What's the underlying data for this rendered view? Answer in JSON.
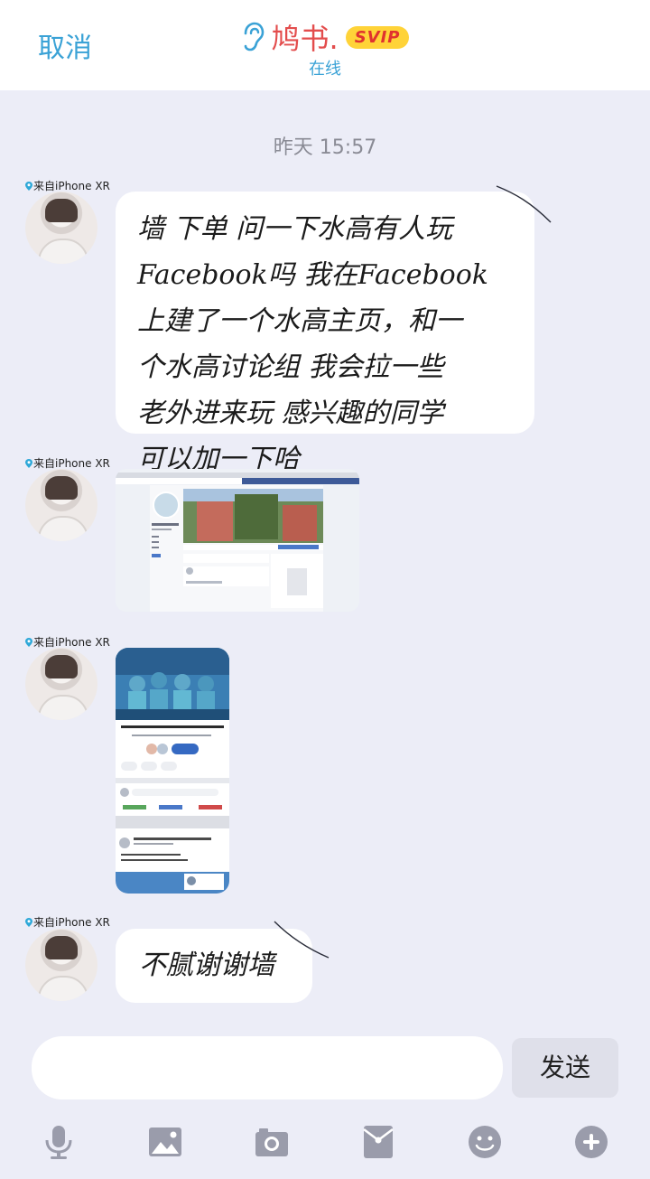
{
  "header": {
    "cancel_label": "取消",
    "title": "鸠书.",
    "badge": "SVIP",
    "status": "在线"
  },
  "chat": {
    "timestamp": "昨天 15:57",
    "messages": [
      {
        "source": "来自iPhone XR",
        "type": "text",
        "lines": [
          "墙 下单 问一下水高有人玩",
          "Facebook吗 我在Facebook",
          "上建了一个水高主页，和一",
          "个水高讨论组 我会拉一些",
          "老外进来玩 感兴趣的同学",
          "可以加一下哈"
        ]
      },
      {
        "source": "来自iPhone XR",
        "type": "image"
      },
      {
        "source": "来自iPhone XR",
        "type": "image"
      },
      {
        "source": "来自iPhone XR",
        "type": "text",
        "lines": [
          "不腻谢谢墙"
        ]
      }
    ]
  },
  "input": {
    "placeholder": "",
    "send_label": "发送"
  },
  "toolbar": {
    "icons": [
      "microphone-icon",
      "image-icon",
      "camera-icon",
      "red-packet-icon",
      "emoji-icon",
      "plus-icon"
    ]
  },
  "colors": {
    "accent": "#3aa2d6",
    "title": "#e34d4d",
    "badge": "#ffd338",
    "background": "#ecedf7",
    "icon": "#9a9cab"
  }
}
